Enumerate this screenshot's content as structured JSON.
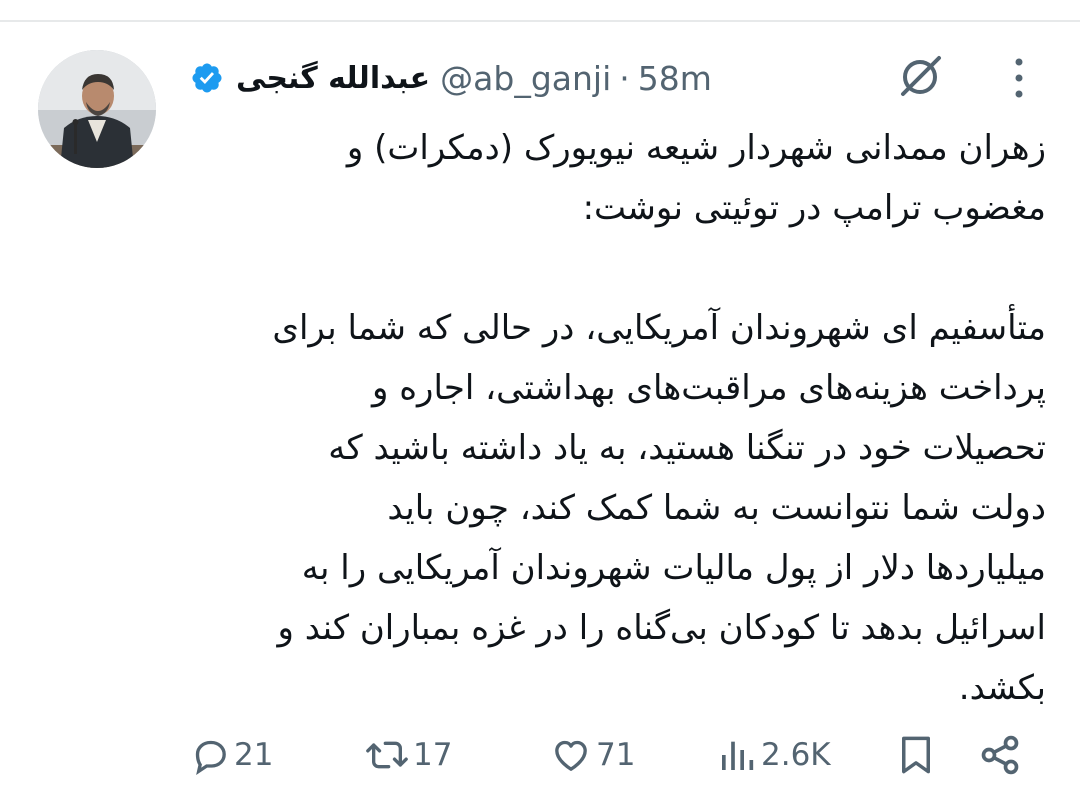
{
  "tweet": {
    "author": {
      "display_name": "عبدالله گنجی",
      "handle": "@ab_ganji",
      "verified": true,
      "verified_color": "#1d9bf0"
    },
    "separator": "·",
    "time": "58m",
    "text_lines": [
      "زهران ممدانی شهردار شیعه نیویورک (دمکرات) و",
      "مغضوب ترامپ در توئیتی نوشت:",
      "متأسفیم ای شهروندان آمریکایی، در حالی که شما برای",
      "پرداخت هزینه‌های مراقبت‌های بهداشتی، اجاره و",
      "تحصیلات خود در تنگنا هستید، به یاد داشته باشید که",
      "دولت شما نتوانست به شما کمک کند، چون باید",
      "میلیاردها دلار از پول مالیات شهروندان آمریکایی را به",
      "اسرائیل بدهد تا کودکان بی‌گناه را در غزه بمباران کند و",
      "بکشد."
    ],
    "actions": {
      "replies": "21",
      "reposts": "17",
      "likes": "71",
      "views": "2.6K"
    }
  },
  "icons": {
    "top_right": [
      "grok-icon",
      "more-options-icon"
    ],
    "action_bar": [
      "reply-icon",
      "repost-icon",
      "like-icon",
      "views-icon",
      "bookmark-icon",
      "share-icon"
    ]
  },
  "colors": {
    "text_primary": "#0f1419",
    "text_secondary": "#536471",
    "accent": "#1d9bf0"
  }
}
